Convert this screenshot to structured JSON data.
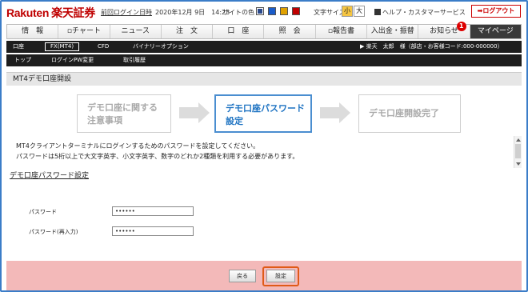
{
  "header": {
    "logo_en": "Rakuten",
    "logo_jp": "楽天証券",
    "last_login_label": "前回ログイン日時",
    "last_login_time": "2020年12月 9日　14:23",
    "site_color_label": "サイトの色",
    "site_colors": [
      "#2b4a8c",
      "#1a5cc9",
      "#e0a100",
      "#c00000"
    ],
    "font_size_label": "文字サイズ",
    "font_small": "小",
    "font_large": "大",
    "help_label": "ヘルプ・カスタマーサービス",
    "logout_label": "ログアウト"
  },
  "nav": {
    "items": [
      "情　報",
      "チャート",
      "ニュース",
      "注　文",
      "口　座",
      "照　会",
      "報告書",
      "入出金・振替",
      "お知らせ",
      "マイページ"
    ],
    "notification_badge": "1"
  },
  "subnav": {
    "items": [
      "口座",
      "FX(MT4)",
      "CFD",
      "バイナリーオプション"
    ],
    "user_info": "▶ 楽天　太郎　様（部店・お客様コード:000-000000）",
    "items2": [
      "トップ",
      "ログインPW変更",
      "取引履歴"
    ]
  },
  "page": {
    "title": "MT4デモ口座開設",
    "steps": [
      {
        "line1": "デモ口座に関する",
        "line2": "注意事項"
      },
      {
        "line1": "デモ口座パスワード",
        "line2": "設定"
      },
      {
        "line1": "デモ口座開設完了",
        "line2": ""
      }
    ],
    "desc_line1": "MT4クライアントターミナルにログインするためのパスワードを設定してください。",
    "desc_line2": "パスワードは5桁以上で大文字英字、小文字英字、数字のどれか2種類を利用する必要があります。",
    "section_title": "デモ口座パスワード設定",
    "password_label": "パスワード",
    "password_value": "••••••",
    "password_confirm_label": "パスワード(再入力)",
    "password_confirm_value": "••••••",
    "back_button": "戻る",
    "submit_button": "設定"
  }
}
